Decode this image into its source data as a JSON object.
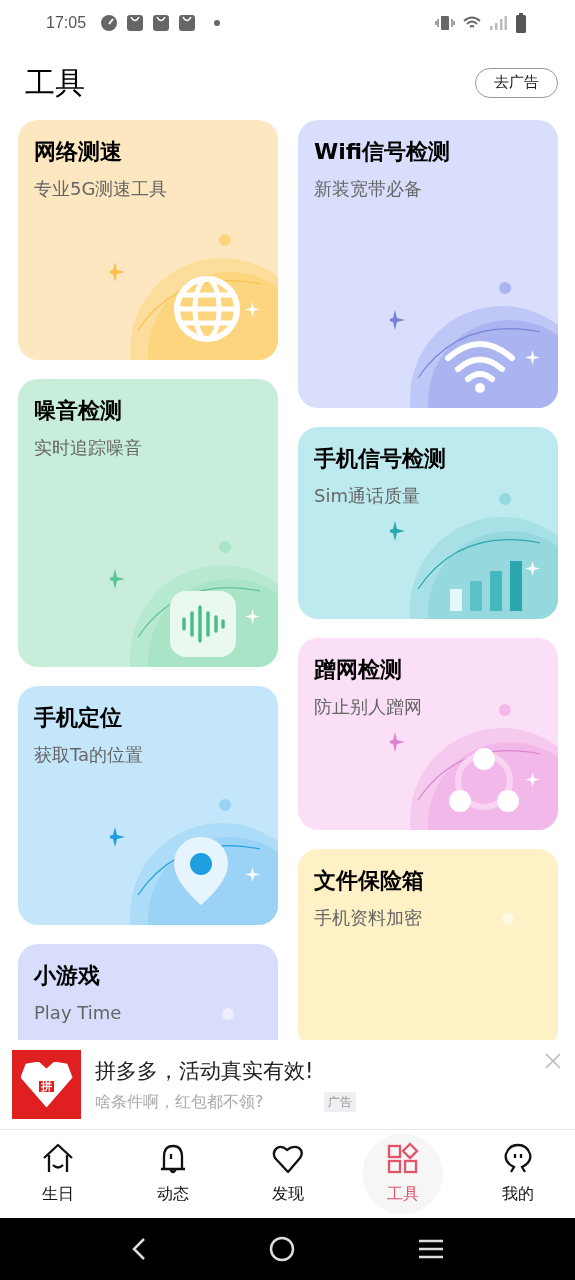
{
  "status_bar": {
    "time": "17:05"
  },
  "header": {
    "title": "工具",
    "action": "去广告"
  },
  "columns": [
    [
      {
        "title": "网络测速",
        "subtitle": "专业5G测速工具",
        "color": "#fde7c0",
        "kind": "globe"
      },
      {
        "title": "噪音检测",
        "subtitle": "实时追踪噪音",
        "color": "#c8eedb",
        "kind": "voice"
      },
      {
        "title": "手机定位",
        "subtitle": "获取Ta的位置",
        "color": "#c3e6fb",
        "kind": "pin"
      },
      {
        "title": "小游戏",
        "subtitle": "Play Time",
        "color": "#d8ddfc",
        "kind": "plain"
      }
    ],
    [
      {
        "title": "Wifi信号检测",
        "subtitle": "新装宽带必备",
        "color": "#d9defc",
        "kind": "wifi"
      },
      {
        "title": "手机信号检测",
        "subtitle": "Sim通话质量",
        "color": "#bdeaee",
        "kind": "bars"
      },
      {
        "title": "蹭网检测",
        "subtitle": "防止别人蹭网",
        "color": "#fbdff6",
        "kind": "people"
      },
      {
        "title": "文件保险箱",
        "subtitle": "手机资料加密",
        "color": "#fef1c6",
        "kind": "plain"
      }
    ]
  ],
  "ad": {
    "title": "拼多多，活动真实有效!",
    "subtitle": "啥条件啊，红包都不领?",
    "badge": "广告",
    "logo_text": "拼"
  },
  "nav": [
    {
      "label": "生日",
      "selected": false
    },
    {
      "label": "动态",
      "selected": false
    },
    {
      "label": "发现",
      "selected": false
    },
    {
      "label": "工具",
      "selected": true
    },
    {
      "label": "我的",
      "selected": false
    }
  ]
}
